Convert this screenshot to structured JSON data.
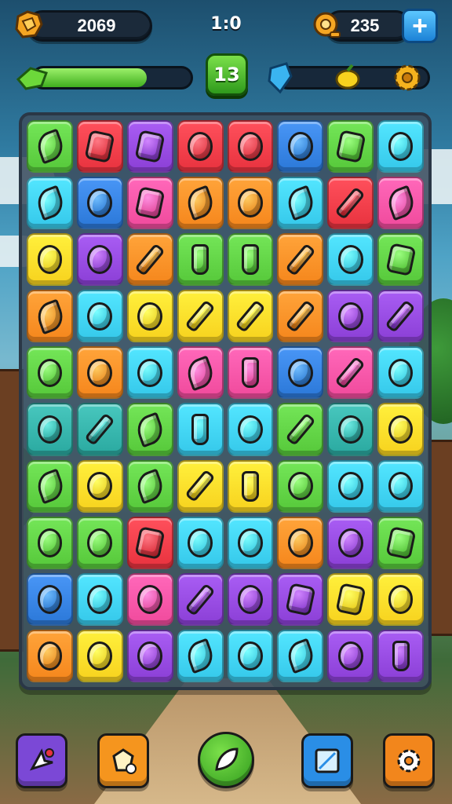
{
  "hud": {
    "coins": "2069",
    "moves": "1:0",
    "gems": "235",
    "level": "13",
    "progress_left": 0.72,
    "progress_right": 0
  },
  "icons": {
    "coin_icon": "fist-badge-icon",
    "gem_icon": "key-badge-icon",
    "plus_icon": "plus-icon",
    "left_bar_icon": "green-leaf-icon",
    "right_bar_icon": "blue-crystal-icon",
    "star_1": "lemon-icon",
    "star_2": "gear-icon"
  },
  "board": {
    "rows": [
      [
        "green",
        "red",
        "purple",
        "red",
        "red",
        "blue",
        "green",
        "cyan"
      ],
      [
        "cyan",
        "blue",
        "pink",
        "orange",
        "orange",
        "cyan",
        "red",
        "pink"
      ],
      [
        "yellow",
        "purple",
        "orange",
        "green",
        "green",
        "orange",
        "cyan",
        "green"
      ],
      [
        "orange",
        "cyan",
        "yellow",
        "yellow",
        "yellow",
        "orange",
        "purple",
        "purple"
      ],
      [
        "green",
        "orange",
        "cyan",
        "pink",
        "pink",
        "blue",
        "pink",
        "cyan"
      ],
      [
        "teal",
        "teal",
        "green",
        "cyan",
        "cyan",
        "green",
        "teal",
        "yellow"
      ],
      [
        "green",
        "yellow",
        "green",
        "yellow",
        "yellow",
        "green",
        "cyan",
        "cyan"
      ],
      [
        "green",
        "green",
        "red",
        "cyan",
        "cyan",
        "orange",
        "purple",
        "green"
      ],
      [
        "blue",
        "cyan",
        "pink",
        "purple",
        "purple",
        "purple",
        "yellow",
        "yellow"
      ],
      [
        "orange",
        "yellow",
        "purple",
        "cyan",
        "cyan",
        "cyan",
        "purple",
        "purple"
      ]
    ],
    "items": [
      [
        "leaf",
        "square",
        "square",
        "round",
        "round",
        "round",
        "square",
        "round"
      ],
      [
        "leaf",
        "round",
        "square",
        "leaf",
        "round",
        "leaf",
        "stick",
        "leaf"
      ],
      [
        "round",
        "round",
        "stick",
        "bottle",
        "bottle",
        "stick",
        "round",
        "square"
      ],
      [
        "leaf",
        "round",
        "round",
        "stick",
        "stick",
        "stick",
        "round",
        "stick"
      ],
      [
        "round",
        "round",
        "round",
        "leaf",
        "bottle",
        "round",
        "stick",
        "round"
      ],
      [
        "round",
        "stick",
        "leaf",
        "bottle",
        "round",
        "stick",
        "round",
        "round"
      ],
      [
        "leaf",
        "round",
        "leaf",
        "stick",
        "bottle",
        "round",
        "round",
        "round"
      ],
      [
        "round",
        "round",
        "square",
        "round",
        "round",
        "round",
        "round",
        "square"
      ],
      [
        "round",
        "round",
        "round",
        "stick",
        "round",
        "square",
        "square",
        "round"
      ],
      [
        "round",
        "round",
        "round",
        "leaf",
        "round",
        "leaf",
        "round",
        "bottle"
      ]
    ]
  },
  "colors": {
    "green": "#56c83a",
    "red": "#e8323e",
    "purple": "#8b3fd6",
    "blue": "#2b78d8",
    "cyan": "#35c8ea",
    "pink": "#f04a9c",
    "orange": "#f5861c",
    "yellow": "#f7d21e",
    "teal": "#2aa9a0"
  },
  "bottom_bar": [
    {
      "name": "cursor-button",
      "icon": "pointer-icon",
      "color": "#7b48d6"
    },
    {
      "name": "hint-button",
      "icon": "map-piece-icon",
      "color": "#f5951e"
    },
    {
      "name": "play-button",
      "icon": "leaf-icon",
      "color": "#3fbf2c"
    },
    {
      "name": "map-button",
      "icon": "map-icon",
      "color": "#2a8ee6"
    },
    {
      "name": "settings-button",
      "icon": "gear-icon",
      "color": "#f2861c"
    }
  ]
}
